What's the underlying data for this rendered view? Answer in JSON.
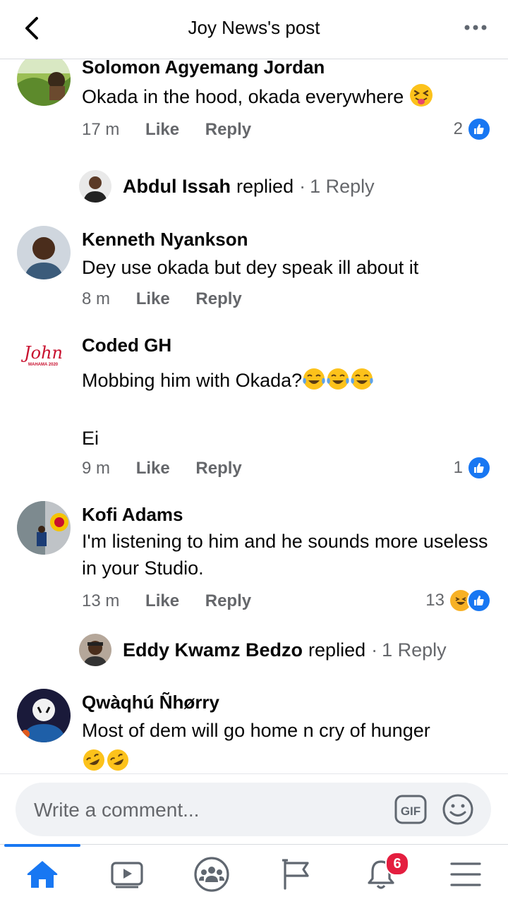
{
  "header": {
    "title": "Joy News's post",
    "back_icon": "chevron-left-icon",
    "more_icon": "more-horizontal-icon"
  },
  "comments": [
    {
      "author": "Solomon Agyemang Jordan",
      "text": "Okada in the hood, okada everywhere",
      "emoji": "squinting-tongue-emoji",
      "time": "17 m",
      "like": "Like",
      "reply": "Reply",
      "reactions": "2"
    },
    {
      "author": "Kenneth Nyankson",
      "text": "Dey use okada but dey  speak ill about  it",
      "time": "8 m",
      "like": "Like",
      "reply": "Reply"
    },
    {
      "author": "Coded GH",
      "text": "Mobbing him with Okada?",
      "text2": "Ei",
      "avatar_text": "John",
      "avatar_sub": "MAHAMA 2020",
      "time": "9 m",
      "like": "Like",
      "reply": "Reply",
      "reactions": "1"
    },
    {
      "author": "Kofi Adams",
      "text": "I'm listening to him and he sounds more useless  in your Studio.",
      "time": "13 m",
      "like": "Like",
      "reply": "Reply",
      "reactions": "13"
    },
    {
      "author": "Qwàqhú Ñhørry",
      "text": "Most of dem will go home n cry of hunger"
    }
  ],
  "replies": [
    {
      "name": "Abdul Issah",
      "action": "replied",
      "sep": "·",
      "count": "1 Reply"
    },
    {
      "name": "Eddy Kwamz Bedzo",
      "action": "replied",
      "sep": "·",
      "count": "1 Reply"
    }
  ],
  "composer": {
    "placeholder": "Write a comment...",
    "gif_label": "GIF"
  },
  "nav": {
    "notifications_badge": "6",
    "active_tab": "home"
  },
  "colors": {
    "accent": "#1877f2",
    "badge": "#e41e3f",
    "meta": "#65676b"
  }
}
